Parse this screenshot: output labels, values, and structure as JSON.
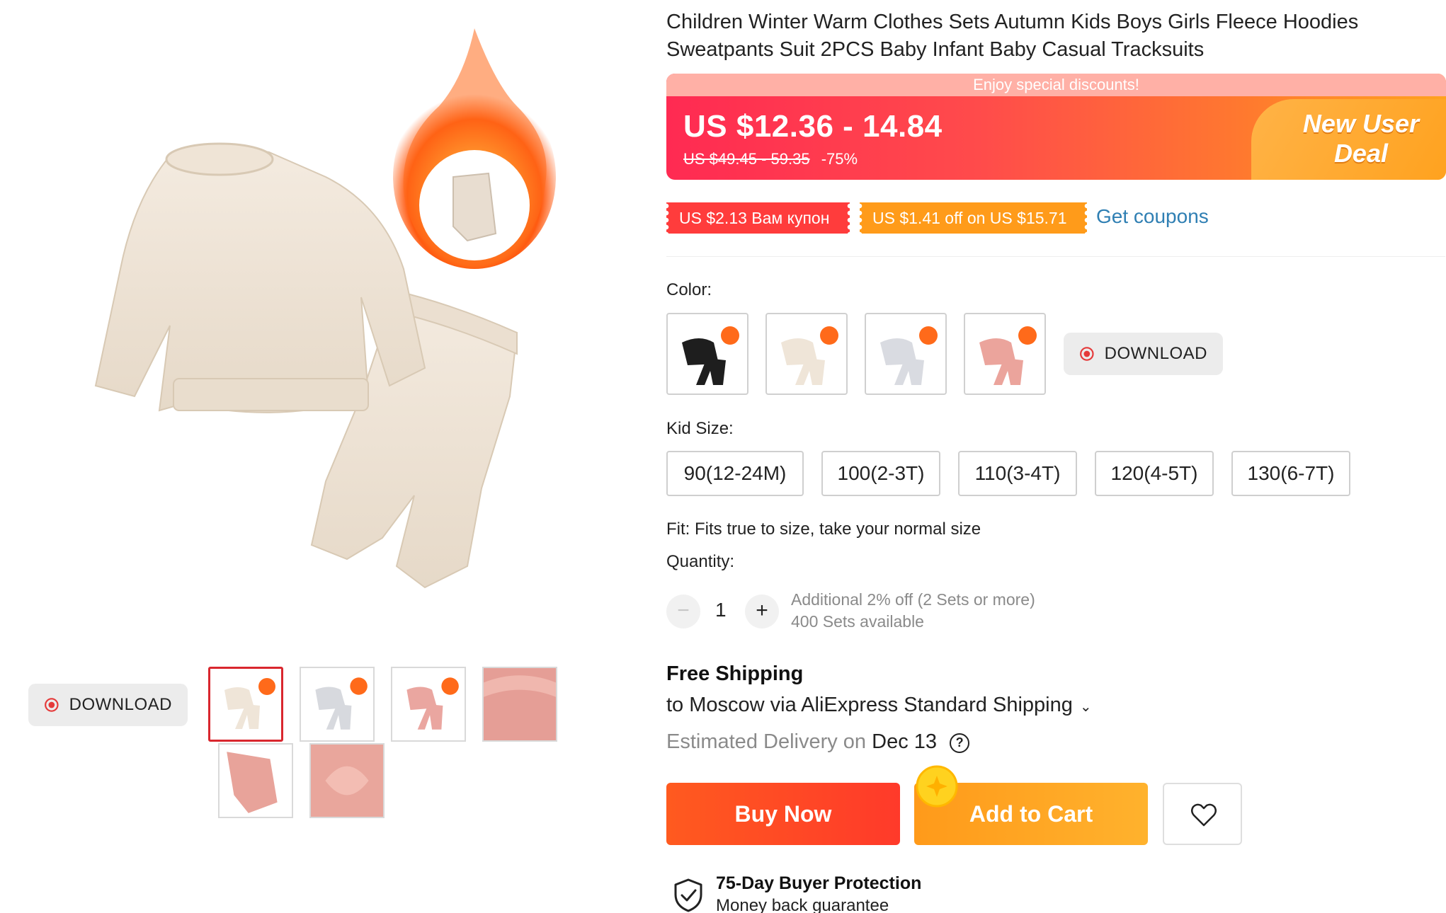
{
  "product": {
    "title": "Children Winter Warm Clothes Sets Autumn Kids Boys Girls Fleece Hoodies Sweatpants Suit 2PCS Baby Infant Baby Casual Tracksuits"
  },
  "gallery": {
    "download_label": "DOWNLOAD",
    "thumbnails": [
      "beige set",
      "gray set",
      "pink set",
      "pink fabric",
      "pink cuff",
      "pink fleece"
    ],
    "selected_index": 0
  },
  "price": {
    "banner": "Enjoy special discounts!",
    "current": "US $12.36 - 14.84",
    "original": "US $49.45 - 59.35",
    "discount": "-75%",
    "deal_line1": "New User",
    "deal_line2": "Deal"
  },
  "coupons": {
    "coupon1": "US $2.13 Вам купон",
    "coupon2": "US $1.41 off on US $15.71",
    "get_coupons": "Get coupons"
  },
  "color": {
    "label": "Color:",
    "options": [
      "black",
      "beige",
      "gray",
      "pink"
    ],
    "download_label": "DOWNLOAD"
  },
  "size": {
    "label": "Kid Size:",
    "options": [
      "90(12-24M)",
      "100(2-3T)",
      "110(3-4T)",
      "120(4-5T)",
      "130(6-7T)"
    ]
  },
  "fit_text": "Fit: Fits true to size, take your normal size",
  "quantity": {
    "label": "Quantity:",
    "minus": "−",
    "plus": "+",
    "value": "1",
    "note": "Additional 2% off (2 Sets or more)",
    "available": "400 Sets available"
  },
  "shipping": {
    "free": "Free Shipping",
    "to": "to Moscow via AliExpress Standard Shipping",
    "est_label": "Estimated Delivery on",
    "date": "Dec 13"
  },
  "actions": {
    "buy_now": "Buy Now",
    "add_to_cart": "Add to Cart"
  },
  "protection": {
    "title": "75-Day Buyer Protection",
    "subtitle": "Money back guarantee"
  },
  "colors": {
    "accent_red": "#ff3c3c",
    "accent_orange": "#ff9b1a",
    "link_blue": "#2f7fb3",
    "selected_border": "#d9272e"
  }
}
